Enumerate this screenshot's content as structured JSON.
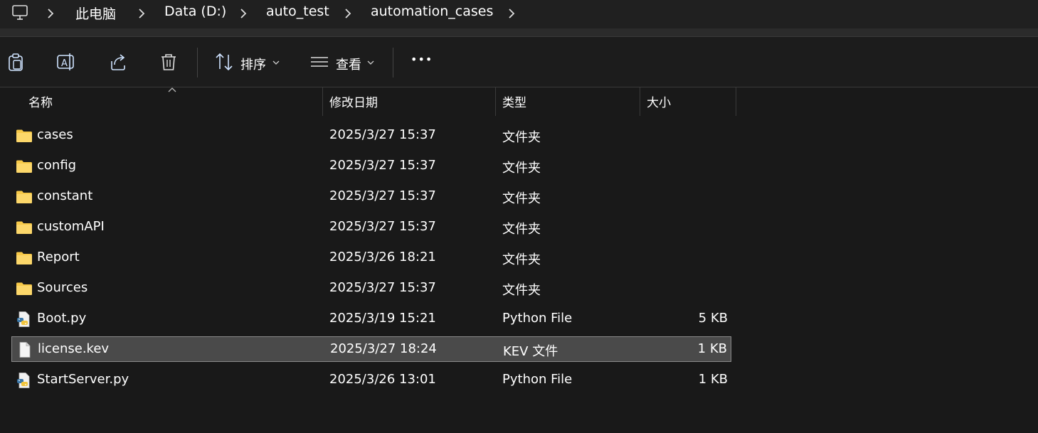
{
  "breadcrumb": [
    "此电脑",
    "Data (D:)",
    "auto_test",
    "automation_cases"
  ],
  "toolbar": {
    "sort_label": "排序",
    "view_label": "查看",
    "more_label": "•••"
  },
  "columns": {
    "name": "名称",
    "date": "修改日期",
    "type": "类型",
    "size": "大小"
  },
  "files": [
    {
      "name": "cases",
      "date": "2025/3/27 15:37",
      "type": "文件夹",
      "size": "",
      "icon": "folder-icon"
    },
    {
      "name": "config",
      "date": "2025/3/27 15:37",
      "type": "文件夹",
      "size": "",
      "icon": "folder-icon"
    },
    {
      "name": "constant",
      "date": "2025/3/27 15:37",
      "type": "文件夹",
      "size": "",
      "icon": "folder-icon"
    },
    {
      "name": "customAPI",
      "date": "2025/3/27 15:37",
      "type": "文件夹",
      "size": "",
      "icon": "folder-icon"
    },
    {
      "name": "Report",
      "date": "2025/3/26 18:21",
      "type": "文件夹",
      "size": "",
      "icon": "folder-icon"
    },
    {
      "name": "Sources",
      "date": "2025/3/27 15:37",
      "type": "文件夹",
      "size": "",
      "icon": "folder-icon"
    },
    {
      "name": "Boot.py",
      "date": "2025/3/19 15:21",
      "type": "Python File",
      "size": "5 KB",
      "icon": "python-file-icon"
    },
    {
      "name": "license.kev",
      "date": "2025/3/27 18:24",
      "type": "KEV 文件",
      "size": "1 KB",
      "icon": "file-icon",
      "selected": true
    },
    {
      "name": "StartServer.py",
      "date": "2025/3/26 13:01",
      "type": "Python File",
      "size": "1 KB",
      "icon": "python-file-icon"
    }
  ],
  "colors": {
    "background": "#191919",
    "folder": "#f7c948",
    "selected_row": "#4a4a4a"
  }
}
